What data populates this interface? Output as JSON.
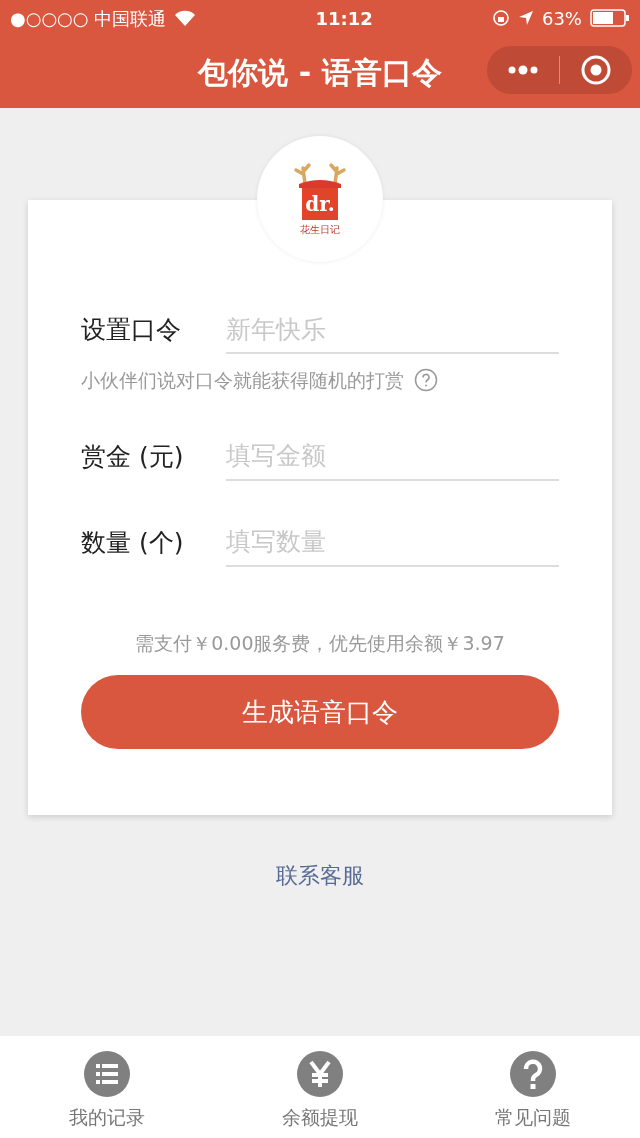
{
  "status_bar": {
    "carrier": "●○○○○ 中国联通",
    "time": "11:12",
    "battery": "63%"
  },
  "header": {
    "title": "包你说 - 语音口令"
  },
  "logo": {
    "mark": "dr.",
    "caption": "花生日记"
  },
  "form": {
    "fields": [
      {
        "label": "设置口令",
        "placeholder": "新年快乐",
        "hint": "小伙伴们说对口令就能获得随机的打赏"
      },
      {
        "label": "赏金 (元)",
        "placeholder": "填写金额"
      },
      {
        "label": "数量 (个)",
        "placeholder": "填写数量"
      }
    ],
    "fee_note": "需支付￥0.00服务费，优先使用余额￥3.97",
    "submit": "生成语音口令"
  },
  "contact_link": "联系客服",
  "tab_bar": [
    {
      "kind": "list",
      "label": "我的记录"
    },
    {
      "kind": "yen",
      "label": "余额提现"
    },
    {
      "kind": "help",
      "label": "常见问题"
    }
  ]
}
